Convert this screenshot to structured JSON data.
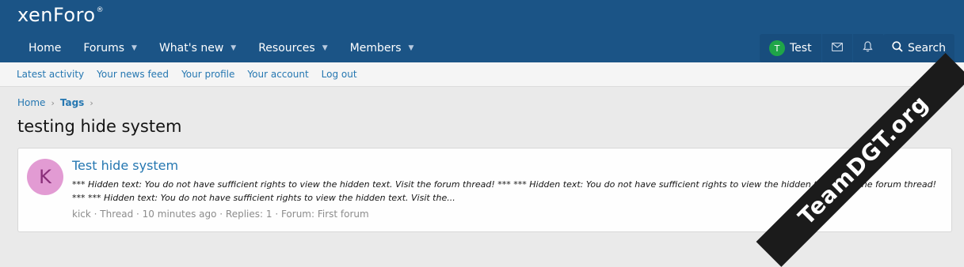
{
  "header": {
    "logo_main": "xenForo",
    "logo_mark": "®"
  },
  "nav": [
    {
      "label": "Home",
      "has_caret": false
    },
    {
      "label": "Forums",
      "has_caret": true
    },
    {
      "label": "What's new",
      "has_caret": true
    },
    {
      "label": "Resources",
      "has_caret": true
    },
    {
      "label": "Members",
      "has_caret": true
    }
  ],
  "user": {
    "avatar_letter": "T",
    "name": "Test"
  },
  "search": {
    "label": "Search"
  },
  "subnav": [
    "Latest activity",
    "Your news feed",
    "Your profile",
    "Your account",
    "Log out"
  ],
  "breadcrumb": {
    "home": "Home",
    "tags": "Tags"
  },
  "page": {
    "title": "testing hide system"
  },
  "result": {
    "avatar_letter": "K",
    "title": "Test hide system",
    "snippet": "*** Hidden text: You do not have sufficient rights to view the hidden text. Visit the forum thread! *** *** Hidden text: You do not have sufficient rights to view the hidden text. Visit the forum thread! *** *** Hidden text: You do not have sufficient rights to view the hidden text. Visit the...",
    "meta": "kick · Thread · 10 minutes ago · Replies: 1 · Forum: First forum"
  },
  "watermark": {
    "text": "TeamDGT.org"
  }
}
